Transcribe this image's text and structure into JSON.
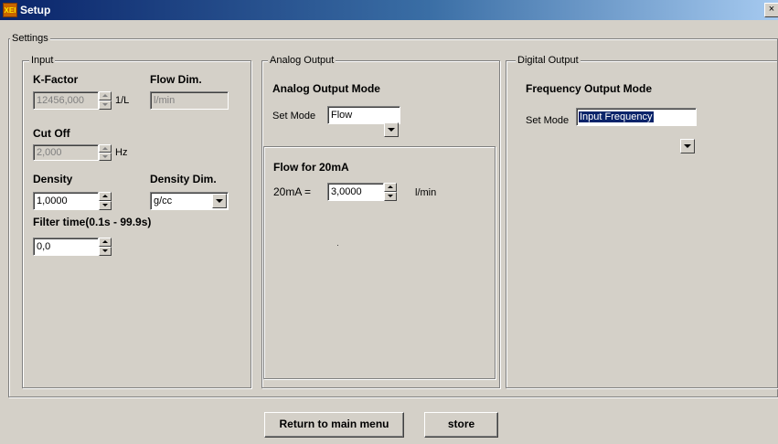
{
  "window": {
    "title": "Setup",
    "icon_text": "XEI",
    "close_label": "×"
  },
  "settings": {
    "legend": "Settings",
    "input": {
      "legend": "Input",
      "k_factor_label": "K-Factor",
      "k_factor_value": "12456,000",
      "k_factor_unit": "1/L",
      "flow_dim_label": "Flow Dim.",
      "flow_dim_value": "l/min",
      "cut_off_label": "Cut Off",
      "cut_off_value": "2,000",
      "cut_off_unit": "Hz",
      "density_label": "Density",
      "density_value": "1,0000",
      "density_dim_label": "Density Dim.",
      "density_dim_value": "g/cc",
      "filter_time_label": "Filter time(0.1s - 99.9s)",
      "filter_time_value": "0,0"
    },
    "analog": {
      "legend": "Analog Output",
      "mode_title": "Analog Output Mode",
      "set_mode_label": "Set Mode",
      "set_mode_value": "Flow",
      "flow_title": "Flow for 20mA",
      "ma_label": "20mA =",
      "ma_value": "3,0000",
      "ma_unit": "l/min"
    },
    "digital": {
      "legend": "Digital Output",
      "mode_title": "Frequency Output Mode",
      "set_mode_label": "Set Mode",
      "set_mode_value": "Input Frequency"
    }
  },
  "footer": {
    "return_label": "Return to main menu",
    "store_label": "store"
  },
  "colors": {
    "face": "#d4d0c8",
    "title_start": "#0a246a",
    "title_end": "#a6caf0",
    "highlight": "#0a246a"
  }
}
